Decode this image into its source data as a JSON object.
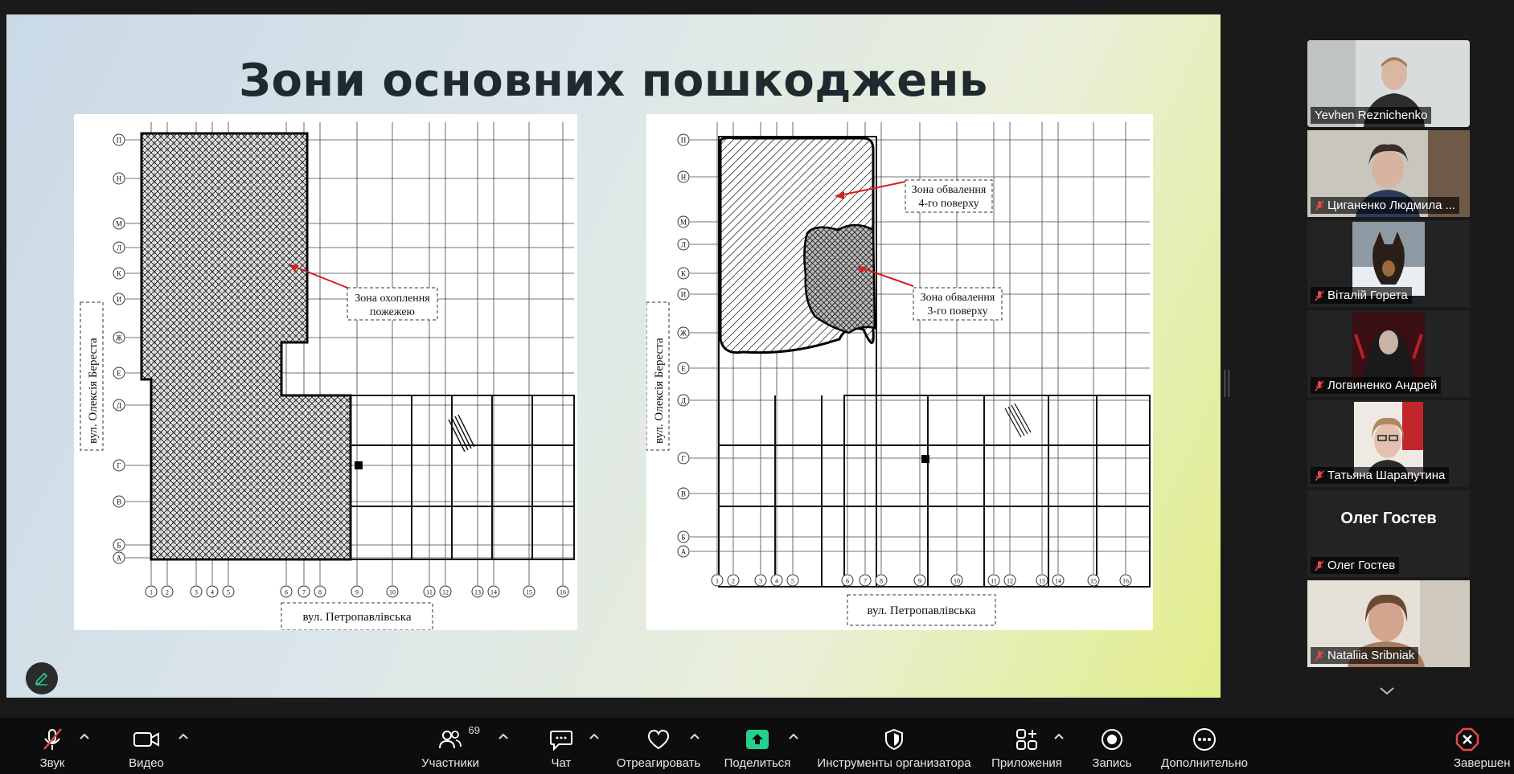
{
  "slide": {
    "title": "Зони основних пошкоджень",
    "left_plan": {
      "street_vertical": "вул. Олексія Береста",
      "street_bottom": "вул. Петропавлівська",
      "callout_line1": "Зона охоплення",
      "callout_line2": "пожежею",
      "row_axes": [
        "П",
        "Н",
        "М",
        "Л",
        "К",
        "И",
        "Ж",
        "Е",
        "Д",
        "Г",
        "В",
        "Б",
        "А"
      ],
      "col_axes": [
        "1",
        "2",
        "3",
        "4",
        "5",
        "6",
        "7",
        "8",
        "9",
        "10",
        "11",
        "12",
        "13",
        "14",
        "15",
        "16"
      ]
    },
    "right_plan": {
      "street_vertical": "вул. Олексія Береста",
      "street_bottom": "вул. Петропавлівська",
      "callout1_line1": "Зона обвалення",
      "callout1_line2": "4-го поверху",
      "callout2_line1": "Зона обвалення",
      "callout2_line2": "3-го поверху",
      "row_axes": [
        "П",
        "Н",
        "М",
        "Л",
        "К",
        "И",
        "Ж",
        "Е",
        "Д",
        "Г",
        "В",
        "Б",
        "А"
      ],
      "col_axes": [
        "1",
        "2",
        "3",
        "4",
        "5",
        "6",
        "7",
        "8",
        "9",
        "10",
        "11",
        "12",
        "13",
        "14",
        "15",
        "16"
      ]
    }
  },
  "participants": [
    {
      "name": "Yevhen Reznichenko",
      "muted": false,
      "active": true
    },
    {
      "name": "Циганенко Людмила ...",
      "muted": true
    },
    {
      "name": "Віталій Горета",
      "muted": true
    },
    {
      "name": "Логвиненко Андрей",
      "muted": true
    },
    {
      "name": "Татьяна Шарапутина",
      "muted": true
    },
    {
      "name": "Олег Гостев",
      "display_name": "Олег Гостев",
      "muted": true
    },
    {
      "name": "Nataliia Sribniak",
      "muted": true
    }
  ],
  "toolbar": {
    "audio": "Звук",
    "video": "Видео",
    "participants": "Участники",
    "participants_count": "69",
    "chat": "Чат",
    "react": "Отреагировать",
    "share": "Поделиться",
    "host_tools": "Инструменты организатора",
    "apps": "Приложения",
    "record": "Запись",
    "more": "Дополнительно",
    "end": "Завершен"
  },
  "colors": {
    "active_speaker": "#23d18b",
    "share_green": "#23d18b",
    "mute_red": "#e5484d",
    "end_red": "#e5484d"
  }
}
